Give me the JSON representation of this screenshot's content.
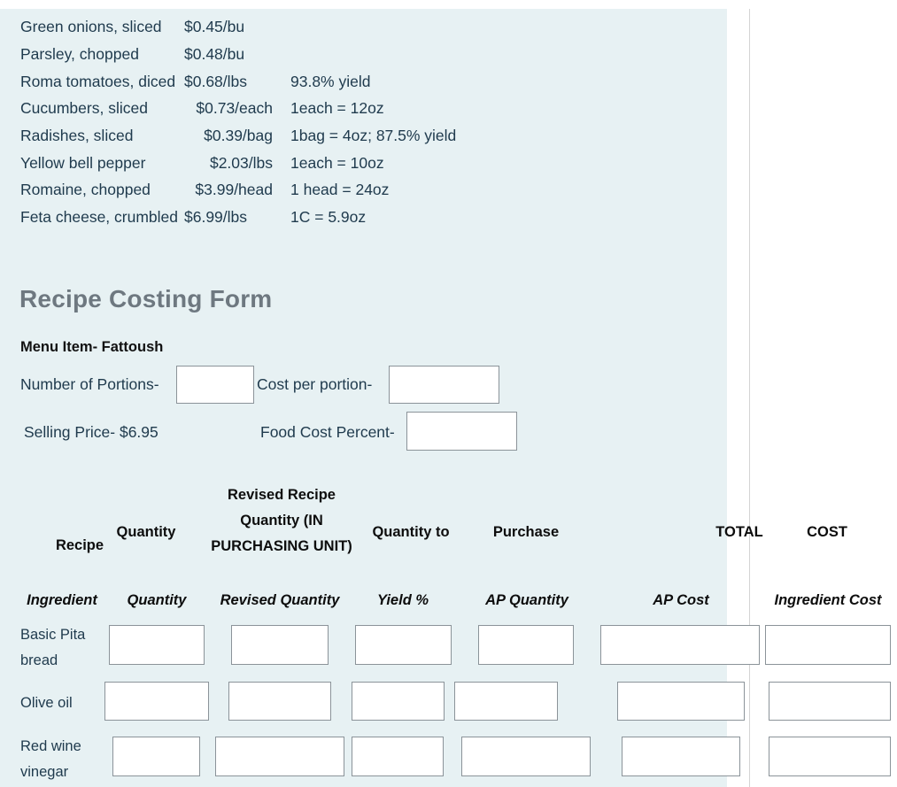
{
  "ingredient_prices": [
    {
      "name": "Green onions, sliced",
      "price": "$0.45/bu",
      "note": ""
    },
    {
      "name": "Parsley, chopped",
      "price": "$0.48/bu",
      "note": ""
    },
    {
      "name": "Roma tomatoes, diced",
      "price": "$0.68/lbs",
      "note": "93.8% yield"
    },
    {
      "name": "Cucumbers, sliced",
      "price": "$0.73/each",
      "note": "1each = 12oz"
    },
    {
      "name": "Radishes, sliced",
      "price": "$0.39/bag",
      "note": "1bag = 4oz; 87.5% yield"
    },
    {
      "name": "Yellow bell pepper",
      "price": "$2.03/lbs",
      "note": "1each = 10oz"
    },
    {
      "name": "Romaine, chopped",
      "price": "$3.99/head",
      "note": "1 head = 24oz"
    },
    {
      "name": "Feta cheese, crumbled",
      "price": "$6.99/lbs",
      "note": "1C = 5.9oz"
    }
  ],
  "form": {
    "title": "Recipe Costing Form",
    "menu_item_label": "Menu Item- Fattoush",
    "portions_label": "Number of Portions-",
    "portions_value": "",
    "cost_per_portion_label": "Cost per portion-",
    "cost_per_portion_value": "",
    "selling_price_label": "Selling Price- $6.95",
    "food_cost_percent_label": "Food Cost Percent-",
    "food_cost_percent_value": ""
  },
  "table": {
    "group_headers": {
      "recipe": "Recipe",
      "quantity": "Quantity",
      "revised": "Revised Recipe Quantity (IN PURCHASING UNIT)",
      "quantity_to": "Quantity to",
      "purchase": "Purchase",
      "total": "TOTAL",
      "cost": "COST"
    },
    "sub_headers": [
      "Ingredient",
      "Quantity",
      "Revised Quantity",
      "Yield %",
      "AP Quantity",
      "AP Cost",
      "Ingredient Cost"
    ],
    "rows": [
      {
        "ingredient": "Basic Pita bread",
        "quantity": "",
        "revised_quantity": "",
        "yield_percent": "",
        "ap_quantity": "",
        "ap_cost": "",
        "ingredient_cost": ""
      },
      {
        "ingredient": "Olive oil",
        "quantity": "",
        "revised_quantity": "",
        "yield_percent": "",
        "ap_quantity": "",
        "ap_cost": "",
        "ingredient_cost": ""
      },
      {
        "ingredient": "Red wine vinegar",
        "quantity": "",
        "revised_quantity": "",
        "yield_percent": "",
        "ap_quantity": "",
        "ap_cost": "",
        "ingredient_cost": ""
      }
    ]
  },
  "colors": {
    "panel_tint": "#e7f1f3",
    "heading": "#6e7880",
    "body_text": "#1f3a4d",
    "field_border": "#8b9399"
  }
}
